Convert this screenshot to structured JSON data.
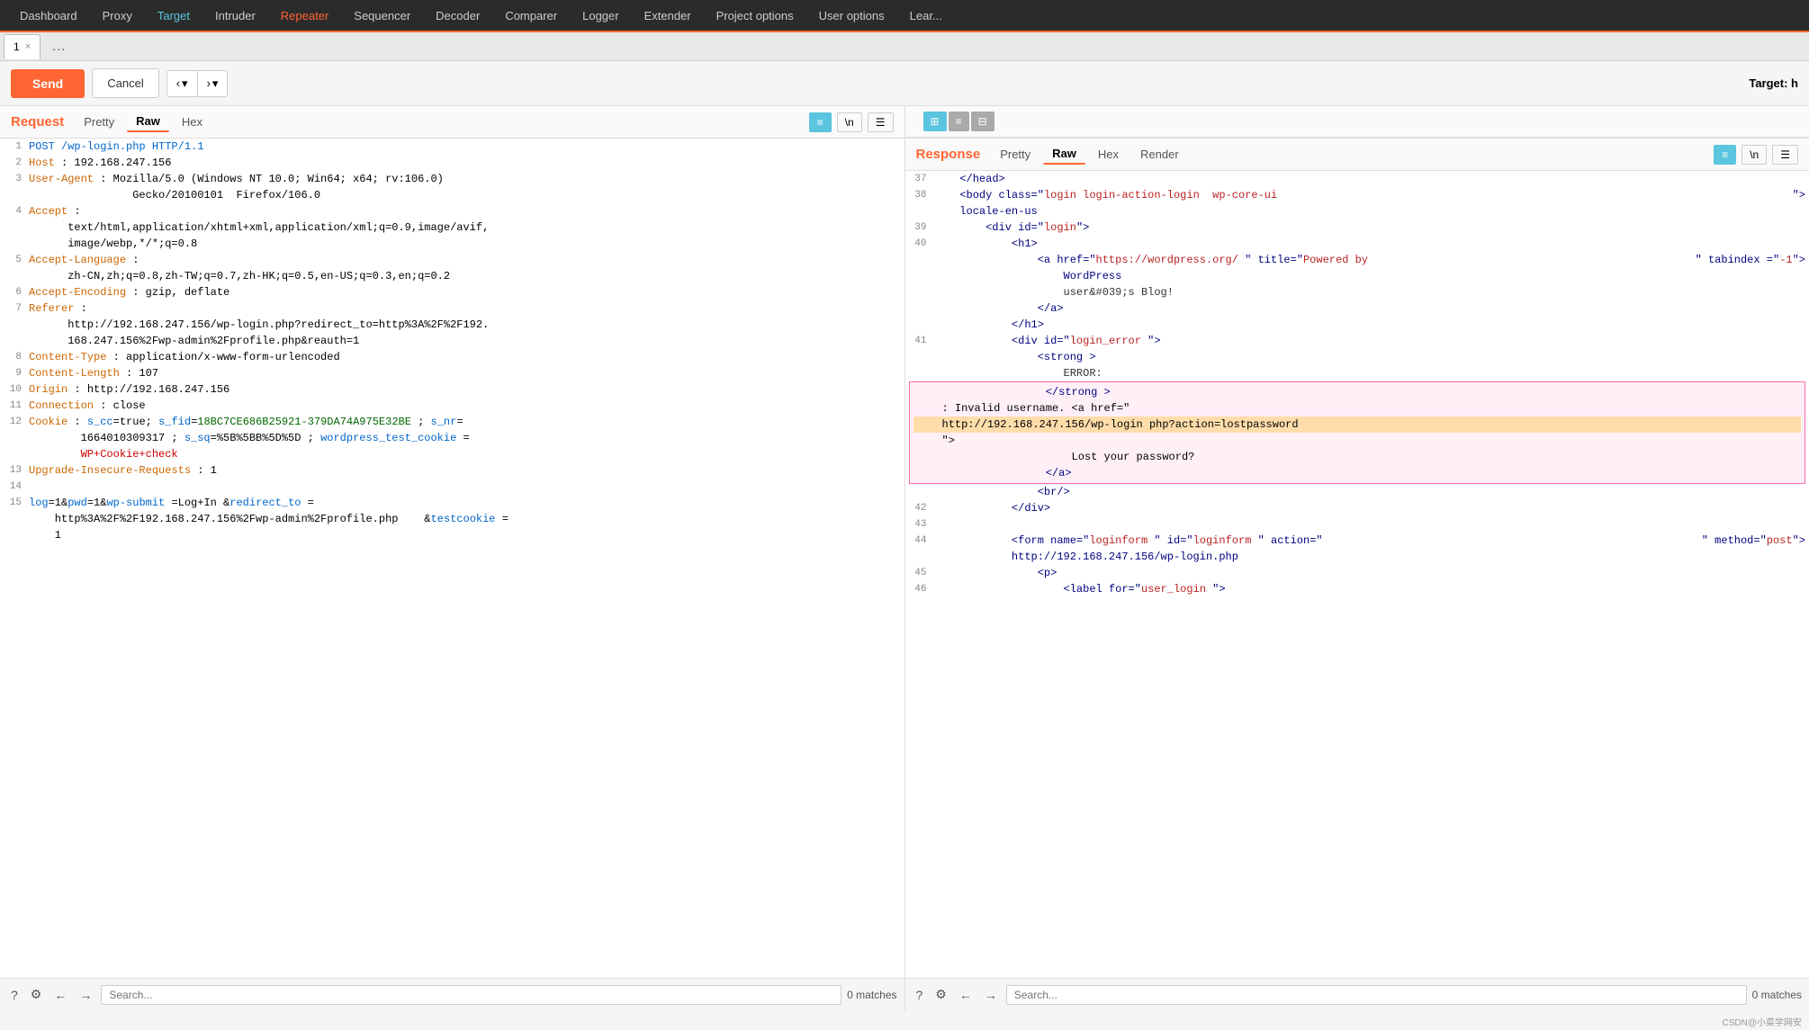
{
  "nav": {
    "items": [
      {
        "label": "Dashboard",
        "state": "normal"
      },
      {
        "label": "Proxy",
        "state": "normal"
      },
      {
        "label": "Target",
        "state": "active-blue"
      },
      {
        "label": "Intruder",
        "state": "normal"
      },
      {
        "label": "Repeater",
        "state": "active"
      },
      {
        "label": "Sequencer",
        "state": "normal"
      },
      {
        "label": "Decoder",
        "state": "normal"
      },
      {
        "label": "Comparer",
        "state": "normal"
      },
      {
        "label": "Logger",
        "state": "normal"
      },
      {
        "label": "Extender",
        "state": "normal"
      },
      {
        "label": "Project options",
        "state": "normal"
      },
      {
        "label": "User options",
        "state": "normal"
      },
      {
        "label": "Lear...",
        "state": "normal"
      }
    ]
  },
  "tabs": {
    "active_label": "1",
    "close_symbol": "×",
    "dots_label": "…"
  },
  "toolbar": {
    "send_label": "Send",
    "cancel_label": "Cancel",
    "back_arrow": "‹",
    "forward_arrow": "›",
    "dropdown_arrow": "▾",
    "target_label": "Target: h"
  },
  "request_panel": {
    "title": "Request",
    "view_tabs": [
      "Pretty",
      "Raw",
      "Hex"
    ],
    "active_tab": "Raw",
    "tools": {
      "list_icon": "≡",
      "newline_icon": "\\n",
      "menu_icon": "☰"
    },
    "lines": [
      {
        "num": "1",
        "content": "POST /wp-login.php HTTP/1.1",
        "type": "http-first"
      },
      {
        "num": "2",
        "content": "Host : 192.168.247.156",
        "type": "header"
      },
      {
        "num": "3",
        "content": "User-Agent : Mozilla/5.0 (Windows NT 10.0; Win64; x64; rv:106.0) Gecko/20100101 Firefox/106.0",
        "type": "header"
      },
      {
        "num": "4",
        "content": "Accept :\ntext/html,application/xhtml+xml,application/xml;q=0.9,image/avif,\nimage/webp,*/*;q=0.8",
        "type": "header"
      },
      {
        "num": "5",
        "content": "Accept-Language :\nzh-CN,zh;q=0.8,zh-TW;q=0.7,zh-HK;q=0.5,en-US;q=0.3,en;q=0.2",
        "type": "header"
      },
      {
        "num": "6",
        "content": "Accept-Encoding : gzip, deflate",
        "type": "header"
      },
      {
        "num": "7",
        "content": "Referer :\nhttp://192.168.247.156/wp-login.php?redirect_to=http%3A%2F%2F192.\n168.247.156%2Fwp-admin%2Fprofile.php&reauth=1",
        "type": "header"
      },
      {
        "num": "8",
        "content": "Content-Type : application/x-www-form-urlencoded",
        "type": "header"
      },
      {
        "num": "9",
        "content": "Content-Length : 107",
        "type": "header"
      },
      {
        "num": "10",
        "content": "Origin : http://192.168.247.156",
        "type": "header"
      },
      {
        "num": "11",
        "content": "Connection : close",
        "type": "header"
      },
      {
        "num": "12",
        "content": "Cookie : s_cc=true; s_fid=18BC7CE686B25921-379DA74A975E32BE ; s_nr=\n1664010309317 ; s_sq=%5B%5BB%5D%5D ; wordpress_test_cookie =\nWP+Cookie+check",
        "type": "cookie"
      },
      {
        "num": "13",
        "content": "Upgrade-Insecure-Requests : 1",
        "type": "header"
      },
      {
        "num": "14",
        "content": "",
        "type": "blank"
      },
      {
        "num": "15",
        "content": "log=1&pwd=1&wp-submit =Log+In &redirect_to =\nhttp%3A%2F%2F192.168.247.156%2Fwp-admin%2Fprofile.php    &testcookie =\n1",
        "type": "body"
      }
    ]
  },
  "response_panel": {
    "title": "Response",
    "view_tabs": [
      "Pretty",
      "Raw",
      "Hex",
      "Render"
    ],
    "active_tab": "Raw",
    "tools": {
      "list_icon": "≡",
      "newline_icon": "\\n",
      "menu_icon": "☰"
    },
    "layout_buttons": [
      "⊞",
      "≡",
      "⊟"
    ],
    "lines": [
      {
        "num": "37",
        "content": "    </head>",
        "type": "tag"
      },
      {
        "num": "38",
        "content": "    <body class=\"login login-action-login  wp-core-ui\n    locale-en-us \">",
        "type": "tag"
      },
      {
        "num": "39",
        "content": "        <div id=\"login\">",
        "type": "tag"
      },
      {
        "num": "40",
        "content": "            <h1>",
        "type": "tag"
      },
      {
        "num": "",
        "content": "                <a href=\"https://wordpress.org/ \" title=\"Powered by\n                WordPress \" tabindex =\"-1\">",
        "type": "tag"
      },
      {
        "num": "",
        "content": "                    user&#039;s Blog!",
        "type": "text"
      },
      {
        "num": "",
        "content": "                </a>",
        "type": "tag"
      },
      {
        "num": "",
        "content": "            </h1>",
        "type": "tag"
      },
      {
        "num": "41",
        "content": "            <div id=\"login_error \">",
        "type": "tag"
      },
      {
        "num": "",
        "content": "                <strong >",
        "type": "tag"
      },
      {
        "num": "",
        "content": "                    ERROR:",
        "type": "text"
      },
      {
        "num": "",
        "content": "                </strong >",
        "type": "tag-highlight"
      },
      {
        "num": "",
        "content": ": Invalid username. <a href=\"",
        "type": "text-highlight"
      },
      {
        "num": "",
        "content": "http://192.168.247.156/wp-login php?action=lostpassword",
        "type": "url-highlight"
      },
      {
        "num": "",
        "content": "\">",
        "type": "text-highlight2"
      },
      {
        "num": "",
        "content": "                    Lost your password?",
        "type": "text-highlight3"
      },
      {
        "num": "",
        "content": "                </a>",
        "type": "tag-highlight2"
      },
      {
        "num": "",
        "content": "                <br/>",
        "type": "tag"
      },
      {
        "num": "42",
        "content": "            </div>",
        "type": "tag"
      },
      {
        "num": "43",
        "content": "",
        "type": "blank"
      },
      {
        "num": "44",
        "content": "            <form name=\"loginform \" id=\"loginform \" action=\"\n            http://192.168.247.156/wp-login.php \" method=\"post\">",
        "type": "tag"
      },
      {
        "num": "45",
        "content": "                <p>",
        "type": "tag"
      },
      {
        "num": "46",
        "content": "                    <label for=\"user_login \">",
        "type": "tag"
      }
    ]
  },
  "bottom_bars": {
    "request": {
      "search_placeholder": "Search...",
      "match_count": "0 matches"
    },
    "response": {
      "search_placeholder": "Search...",
      "match_count": "0 matches"
    }
  },
  "watermark": "CSDN@小菜学网安"
}
